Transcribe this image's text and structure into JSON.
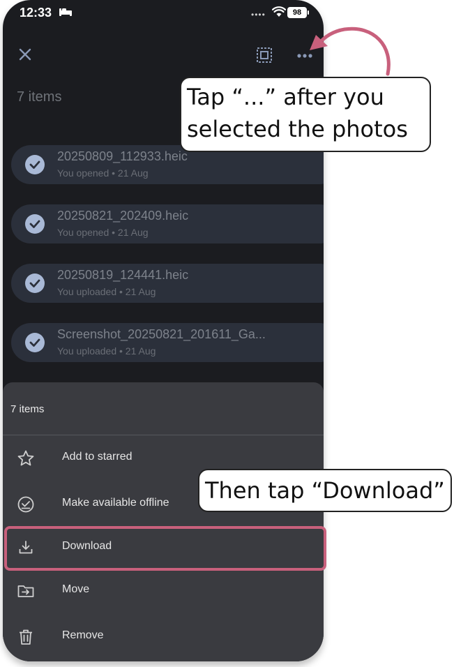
{
  "status_bar": {
    "time": "12:33",
    "battery": "98"
  },
  "header": {
    "items_count": "7 items"
  },
  "files": [
    {
      "name": "20250809_112933.heic",
      "meta": "You opened • 21 Aug"
    },
    {
      "name": "20250821_202409.heic",
      "meta": "You opened • 21 Aug"
    },
    {
      "name": "20250819_124441.heic",
      "meta": "You uploaded • 21 Aug"
    },
    {
      "name": "Screenshot_20250821_201611_Ga...",
      "meta": "You uploaded • 21 Aug"
    }
  ],
  "sheet": {
    "title": "7 items",
    "actions": [
      {
        "label": "Add to starred",
        "icon": "star-icon"
      },
      {
        "label": "Make available offline",
        "icon": "offline-icon"
      },
      {
        "label": "Download",
        "icon": "download-icon"
      },
      {
        "label": "Move",
        "icon": "move-icon"
      },
      {
        "label": "Remove",
        "icon": "trash-icon"
      }
    ]
  },
  "callouts": {
    "step1": [
      "Tap “...” after you",
      "selected the photos"
    ],
    "step2": "Then tap “Download”"
  },
  "colors": {
    "accent": "#c8607c",
    "background": "#1b1c20",
    "sheet": "#3a3b40",
    "file_row": "#2b303b"
  }
}
